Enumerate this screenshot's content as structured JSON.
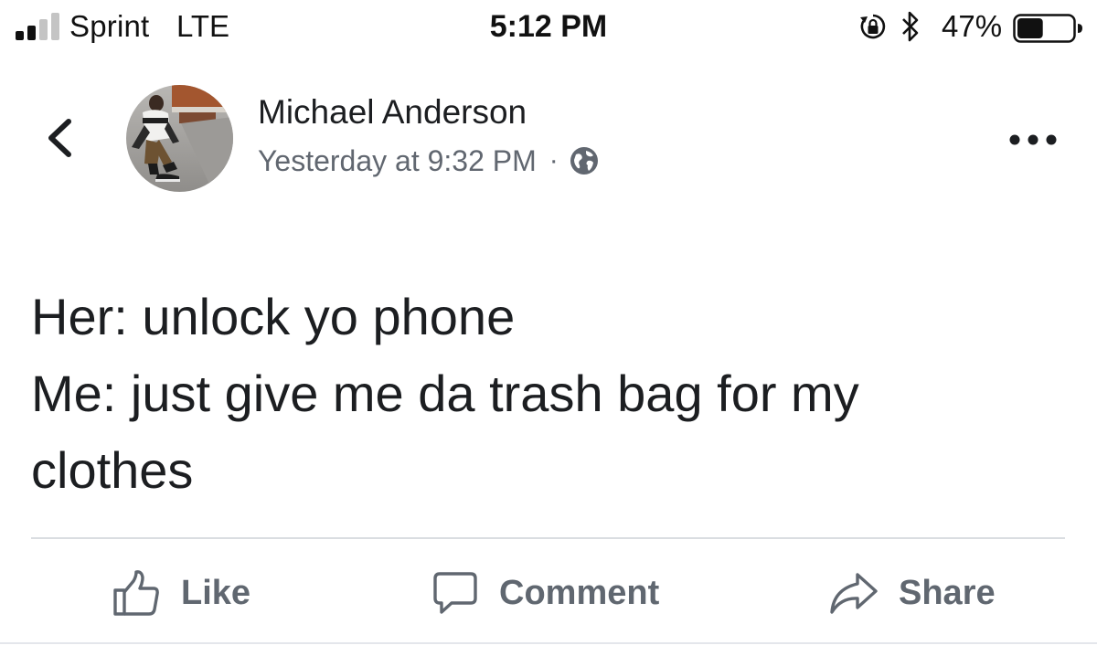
{
  "status_bar": {
    "carrier": "Sprint",
    "network": "LTE",
    "time": "5:12 PM",
    "battery_percent": "47%",
    "battery_level": 0.47,
    "signal_bars_filled": 2,
    "signal_bars_total": 4,
    "icons": [
      "signal-icon",
      "orientation-lock-icon",
      "bluetooth-icon",
      "battery-icon"
    ]
  },
  "post": {
    "author": "Michael Anderson",
    "timestamp": "Yesterday at 9:32 PM",
    "separator": "·",
    "privacy_icon": "globe-icon",
    "lines": [
      "Her: unlock yo phone",
      "Me: just give me da trash bag for my",
      "clothes"
    ]
  },
  "actions": {
    "like_label": "Like",
    "comment_label": "Comment",
    "share_label": "Share"
  },
  "colors": {
    "text_primary": "#1c1e21",
    "text_secondary": "#616770",
    "action_gray": "#606770",
    "divider": "#dadde1"
  }
}
